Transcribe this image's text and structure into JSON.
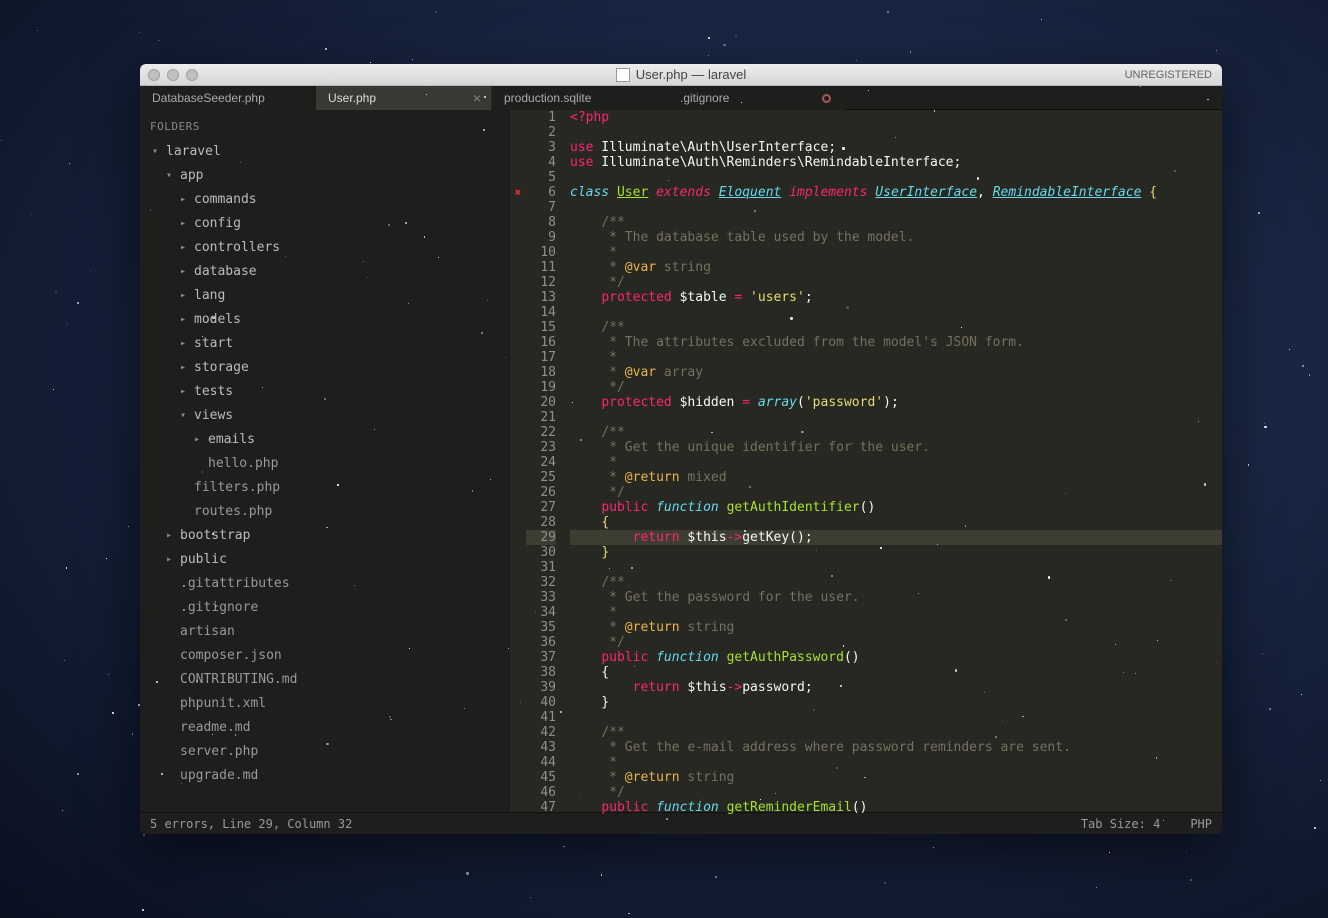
{
  "window": {
    "title": "User.php — laravel",
    "unregistered": "UNREGISTERED"
  },
  "tabs": [
    {
      "label": "DatabaseSeeder.php",
      "active": false
    },
    {
      "label": "User.php",
      "active": true,
      "closeable": true
    },
    {
      "label": "production.sqlite",
      "active": false
    },
    {
      "label": ".gitignore",
      "active": false,
      "dirty": true
    }
  ],
  "sidebar": {
    "header": "FOLDERS",
    "tree": [
      {
        "label": "laravel",
        "type": "folder",
        "open": true,
        "indent": 0
      },
      {
        "label": "app",
        "type": "folder",
        "open": true,
        "indent": 1
      },
      {
        "label": "commands",
        "type": "folder",
        "open": false,
        "indent": 2
      },
      {
        "label": "config",
        "type": "folder",
        "open": false,
        "indent": 2
      },
      {
        "label": "controllers",
        "type": "folder",
        "open": false,
        "indent": 2
      },
      {
        "label": "database",
        "type": "folder",
        "open": false,
        "indent": 2
      },
      {
        "label": "lang",
        "type": "folder",
        "open": false,
        "indent": 2
      },
      {
        "label": "models",
        "type": "folder",
        "open": false,
        "indent": 2
      },
      {
        "label": "start",
        "type": "folder",
        "open": false,
        "indent": 2
      },
      {
        "label": "storage",
        "type": "folder",
        "open": false,
        "indent": 2
      },
      {
        "label": "tests",
        "type": "folder",
        "open": false,
        "indent": 2
      },
      {
        "label": "views",
        "type": "folder",
        "open": true,
        "indent": 2
      },
      {
        "label": "emails",
        "type": "folder",
        "open": false,
        "indent": 3
      },
      {
        "label": "hello.php",
        "type": "file",
        "indent": 3
      },
      {
        "label": "filters.php",
        "type": "file",
        "indent": 2
      },
      {
        "label": "routes.php",
        "type": "file",
        "indent": 2
      },
      {
        "label": "bootstrap",
        "type": "folder",
        "open": false,
        "indent": 1
      },
      {
        "label": "public",
        "type": "folder",
        "open": false,
        "indent": 1
      },
      {
        "label": ".gitattributes",
        "type": "file",
        "indent": 1
      },
      {
        "label": ".gitignore",
        "type": "file",
        "indent": 1
      },
      {
        "label": "artisan",
        "type": "file",
        "indent": 1
      },
      {
        "label": "composer.json",
        "type": "file",
        "indent": 1
      },
      {
        "label": "CONTRIBUTING.md",
        "type": "file",
        "indent": 1
      },
      {
        "label": "phpunit.xml",
        "type": "file",
        "indent": 1
      },
      {
        "label": "readme.md",
        "type": "file",
        "indent": 1
      },
      {
        "label": "server.php",
        "type": "file",
        "indent": 1
      },
      {
        "label": "upgrade.md",
        "type": "file",
        "indent": 1
      }
    ]
  },
  "editor": {
    "highlight_line": 29,
    "error_line": 6,
    "lines": [
      {
        "n": 1,
        "tokens": [
          [
            "kw2",
            "<?php"
          ]
        ]
      },
      {
        "n": 2,
        "tokens": []
      },
      {
        "n": 3,
        "tokens": [
          [
            "kw2",
            "use"
          ],
          [
            "",
            " Illuminate\\Auth\\UserInterface;"
          ]
        ]
      },
      {
        "n": 4,
        "tokens": [
          [
            "kw2",
            "use"
          ],
          [
            "",
            " Illuminate\\Auth\\Reminders\\RemindableInterface;"
          ]
        ]
      },
      {
        "n": 5,
        "tokens": []
      },
      {
        "n": 6,
        "tokens": [
          [
            "st",
            "class"
          ],
          [
            "",
            " "
          ],
          [
            "cls",
            "User"
          ],
          [
            "",
            " "
          ],
          [
            "kw",
            "extends"
          ],
          [
            "",
            " "
          ],
          [
            "iface",
            "Eloquent"
          ],
          [
            "",
            " "
          ],
          [
            "kw",
            "implements"
          ],
          [
            "",
            " "
          ],
          [
            "iface",
            "UserInterface"
          ],
          [
            "",
            ", "
          ],
          [
            "iface",
            "RemindableInterface"
          ],
          [
            "",
            " "
          ],
          [
            "br",
            "{"
          ]
        ]
      },
      {
        "n": 7,
        "tokens": []
      },
      {
        "n": 8,
        "tokens": [
          [
            "",
            "    "
          ],
          [
            "cm",
            "/**"
          ]
        ]
      },
      {
        "n": 9,
        "tokens": [
          [
            "",
            "    "
          ],
          [
            "cm",
            " * The database table used by the model."
          ]
        ]
      },
      {
        "n": 10,
        "tokens": [
          [
            "",
            "    "
          ],
          [
            "cm",
            " *"
          ]
        ]
      },
      {
        "n": 11,
        "tokens": [
          [
            "",
            "    "
          ],
          [
            "cm",
            " * "
          ],
          [
            "ann",
            "@var"
          ],
          [
            "cm",
            " string"
          ]
        ]
      },
      {
        "n": 12,
        "tokens": [
          [
            "",
            "    "
          ],
          [
            "cm",
            " */"
          ]
        ]
      },
      {
        "n": 13,
        "tokens": [
          [
            "",
            "    "
          ],
          [
            "kw2",
            "protected"
          ],
          [
            "",
            " $table "
          ],
          [
            "kw2",
            "="
          ],
          [
            "",
            " "
          ],
          [
            "str",
            "'users'"
          ],
          [
            "",
            ";"
          ]
        ]
      },
      {
        "n": 14,
        "tokens": []
      },
      {
        "n": 15,
        "tokens": [
          [
            "",
            "    "
          ],
          [
            "cm",
            "/**"
          ]
        ]
      },
      {
        "n": 16,
        "tokens": [
          [
            "",
            "    "
          ],
          [
            "cm",
            " * The attributes excluded from the model's JSON form."
          ]
        ]
      },
      {
        "n": 17,
        "tokens": [
          [
            "",
            "    "
          ],
          [
            "cm",
            " *"
          ]
        ]
      },
      {
        "n": 18,
        "tokens": [
          [
            "",
            "    "
          ],
          [
            "cm",
            " * "
          ],
          [
            "ann",
            "@var"
          ],
          [
            "cm",
            " array"
          ]
        ]
      },
      {
        "n": 19,
        "tokens": [
          [
            "",
            "    "
          ],
          [
            "cm",
            " */"
          ]
        ]
      },
      {
        "n": 20,
        "tokens": [
          [
            "",
            "    "
          ],
          [
            "kw2",
            "protected"
          ],
          [
            "",
            " $hidden "
          ],
          [
            "kw2",
            "="
          ],
          [
            "",
            " "
          ],
          [
            "st",
            "array"
          ],
          [
            "",
            "("
          ],
          [
            "str",
            "'password'"
          ],
          [
            "",
            ");"
          ]
        ]
      },
      {
        "n": 21,
        "tokens": []
      },
      {
        "n": 22,
        "tokens": [
          [
            "",
            "    "
          ],
          [
            "cm",
            "/**"
          ]
        ]
      },
      {
        "n": 23,
        "tokens": [
          [
            "",
            "    "
          ],
          [
            "cm",
            " * Get the unique identifier for the user."
          ]
        ]
      },
      {
        "n": 24,
        "tokens": [
          [
            "",
            "    "
          ],
          [
            "cm",
            " *"
          ]
        ]
      },
      {
        "n": 25,
        "tokens": [
          [
            "",
            "    "
          ],
          [
            "cm",
            " * "
          ],
          [
            "ann",
            "@return"
          ],
          [
            "cm",
            " mixed"
          ]
        ]
      },
      {
        "n": 26,
        "tokens": [
          [
            "",
            "    "
          ],
          [
            "cm",
            " */"
          ]
        ]
      },
      {
        "n": 27,
        "tokens": [
          [
            "",
            "    "
          ],
          [
            "kw2",
            "public"
          ],
          [
            "",
            " "
          ],
          [
            "st",
            "function"
          ],
          [
            "",
            " "
          ],
          [
            "fn",
            "getAuthIdentifier"
          ],
          [
            "",
            "()"
          ]
        ]
      },
      {
        "n": 28,
        "tokens": [
          [
            "",
            "    "
          ],
          [
            "br",
            "{"
          ]
        ]
      },
      {
        "n": 29,
        "tokens": [
          [
            "",
            "        "
          ],
          [
            "kw2",
            "return"
          ],
          [
            "",
            " $this"
          ],
          [
            "kw2",
            "->"
          ],
          [
            "",
            "getKey();"
          ]
        ]
      },
      {
        "n": 30,
        "tokens": [
          [
            "",
            "    "
          ],
          [
            "br",
            "}"
          ]
        ]
      },
      {
        "n": 31,
        "tokens": []
      },
      {
        "n": 32,
        "tokens": [
          [
            "",
            "    "
          ],
          [
            "cm",
            "/**"
          ]
        ]
      },
      {
        "n": 33,
        "tokens": [
          [
            "",
            "    "
          ],
          [
            "cm",
            " * Get the password for the user."
          ]
        ]
      },
      {
        "n": 34,
        "tokens": [
          [
            "",
            "    "
          ],
          [
            "cm",
            " *"
          ]
        ]
      },
      {
        "n": 35,
        "tokens": [
          [
            "",
            "    "
          ],
          [
            "cm",
            " * "
          ],
          [
            "ann",
            "@return"
          ],
          [
            "cm",
            " string"
          ]
        ]
      },
      {
        "n": 36,
        "tokens": [
          [
            "",
            "    "
          ],
          [
            "cm",
            " */"
          ]
        ]
      },
      {
        "n": 37,
        "tokens": [
          [
            "",
            "    "
          ],
          [
            "kw2",
            "public"
          ],
          [
            "",
            " "
          ],
          [
            "st",
            "function"
          ],
          [
            "",
            " "
          ],
          [
            "fn",
            "getAuthPassword"
          ],
          [
            "",
            "()"
          ]
        ]
      },
      {
        "n": 38,
        "tokens": [
          [
            "",
            "    {"
          ]
        ]
      },
      {
        "n": 39,
        "tokens": [
          [
            "",
            "        "
          ],
          [
            "kw2",
            "return"
          ],
          [
            "",
            " $this"
          ],
          [
            "kw2",
            "->"
          ],
          [
            "",
            "password;"
          ]
        ]
      },
      {
        "n": 40,
        "tokens": [
          [
            "",
            "    }"
          ]
        ]
      },
      {
        "n": 41,
        "tokens": []
      },
      {
        "n": 42,
        "tokens": [
          [
            "",
            "    "
          ],
          [
            "cm",
            "/**"
          ]
        ]
      },
      {
        "n": 43,
        "tokens": [
          [
            "",
            "    "
          ],
          [
            "cm",
            " * Get the e-mail address where password reminders are sent."
          ]
        ]
      },
      {
        "n": 44,
        "tokens": [
          [
            "",
            "    "
          ],
          [
            "cm",
            " *"
          ]
        ]
      },
      {
        "n": 45,
        "tokens": [
          [
            "",
            "    "
          ],
          [
            "cm",
            " * "
          ],
          [
            "ann",
            "@return"
          ],
          [
            "cm",
            " string"
          ]
        ]
      },
      {
        "n": 46,
        "tokens": [
          [
            "",
            "    "
          ],
          [
            "cm",
            " */"
          ]
        ]
      },
      {
        "n": 47,
        "tokens": [
          [
            "",
            "    "
          ],
          [
            "kw2",
            "public"
          ],
          [
            "",
            " "
          ],
          [
            "st",
            "function"
          ],
          [
            "",
            " "
          ],
          [
            "fn",
            "getReminderEmail"
          ],
          [
            "",
            "()"
          ]
        ]
      }
    ]
  },
  "statusbar": {
    "left": "5 errors, Line 29, Column 32",
    "tabsize": "Tab Size: 4",
    "lang": "PHP"
  }
}
